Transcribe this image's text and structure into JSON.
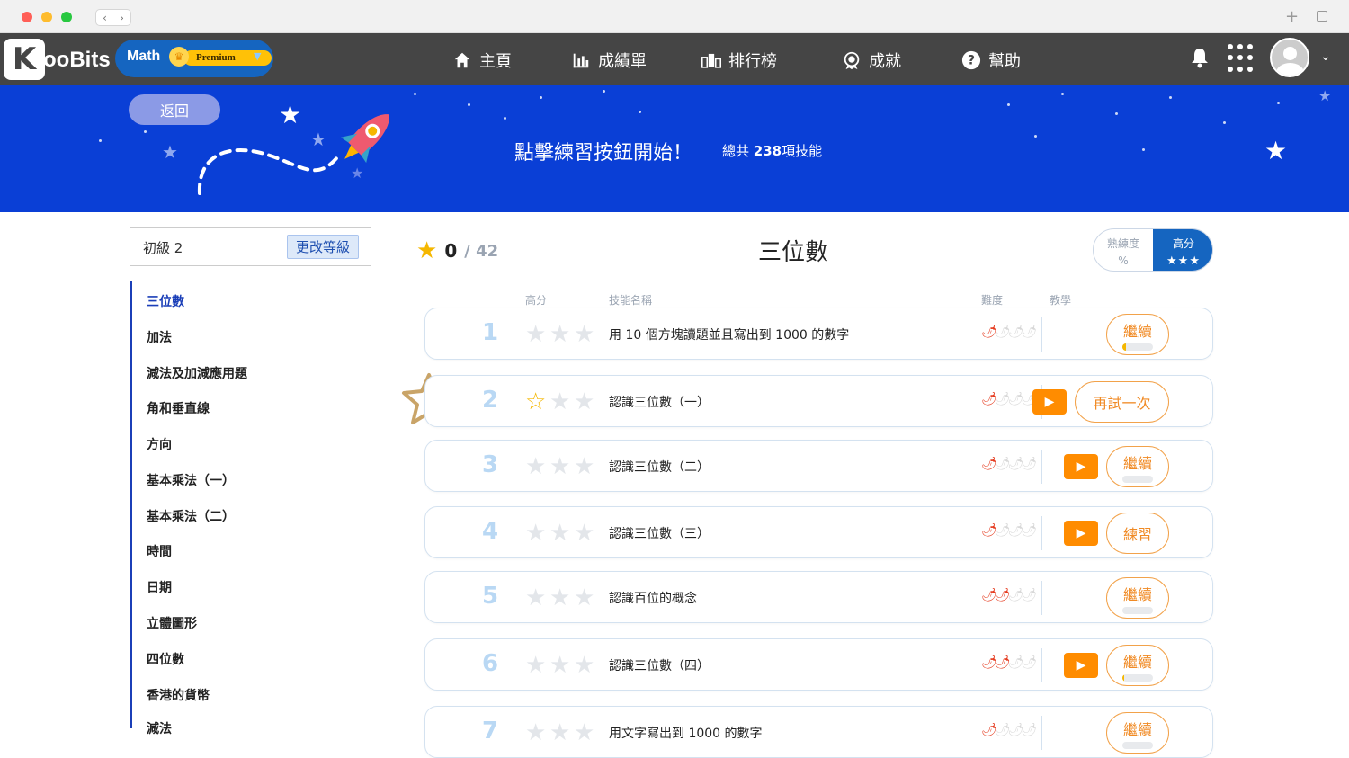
{
  "header": {
    "logo_text": "oo​Bits",
    "logo_letter": "K",
    "subject": "Math",
    "premium_label": "Premium",
    "nav": [
      {
        "label": "主頁",
        "icon": "home-icon"
      },
      {
        "label": "成績單",
        "icon": "bar-chart-icon"
      },
      {
        "label": "排行榜",
        "icon": "leaderboard-icon"
      },
      {
        "label": "成就",
        "icon": "badge-icon"
      },
      {
        "label": "幫助",
        "icon": "help-icon"
      }
    ]
  },
  "banner": {
    "back_label": "返回",
    "title": "點擊練習按鈕開始！",
    "count_prefix": "總共",
    "count_value": "238",
    "count_suffix": "項技能"
  },
  "sidebar": {
    "level": "初級 2",
    "change_level": "更改等級",
    "topics": [
      "三位數",
      "加法",
      "減法及加減應用題",
      "角和垂直線",
      "方向",
      "基本乘法（一）",
      "基本乘法（二）",
      "時間",
      "日期",
      "立體圖形",
      "四位數",
      "香港的貨幣",
      "減法"
    ],
    "active_topic": 0
  },
  "main": {
    "score_value": "0",
    "score_total": "/ 42",
    "title": "三位數",
    "toggle": {
      "opt1_line1": "熟練度",
      "opt1_line2": "%",
      "opt2_line1": "高分",
      "opt2_stars": "★★★"
    },
    "columns": {
      "score": "高分",
      "skill": "技能名稱",
      "difficulty": "難度",
      "tutorial": "教學"
    },
    "rows": [
      {
        "num": "1",
        "stars": 0,
        "skill": "用 10 個方塊讀題並且寫出到 1000 的數字",
        "difficulty": 1,
        "video": false,
        "action": "繼續",
        "progress": 0.12
      },
      {
        "num": "2",
        "stars": 1,
        "skill": "認識三位數（一）",
        "difficulty": 1,
        "video": true,
        "action": "再試一次",
        "progress": null
      },
      {
        "num": "3",
        "stars": 0,
        "skill": "認識三位數（二）",
        "difficulty": 1,
        "video": true,
        "action": "繼續",
        "progress": 0
      },
      {
        "num": "4",
        "stars": 0,
        "skill": "認識三位數（三）",
        "difficulty": 1,
        "video": true,
        "action": "練習",
        "progress": null
      },
      {
        "num": "5",
        "stars": 0,
        "skill": "認識百位的概念",
        "difficulty": 2,
        "video": false,
        "action": "繼續",
        "progress": 0
      },
      {
        "num": "6",
        "stars": 0,
        "skill": "認識三位數（四）",
        "difficulty": 2,
        "video": true,
        "action": "繼續",
        "progress": 0.06
      },
      {
        "num": "7",
        "stars": 0,
        "skill": "用文字寫出到 1000 的數字",
        "difficulty": 1,
        "video": false,
        "action": "繼續",
        "progress": 0
      }
    ]
  },
  "colors": {
    "header_bg": "#454545",
    "banner_bg": "#0a3fd6",
    "accent_blue": "#1565c0",
    "accent_orange": "#ff8c00",
    "star_gold": "#f5b700"
  }
}
